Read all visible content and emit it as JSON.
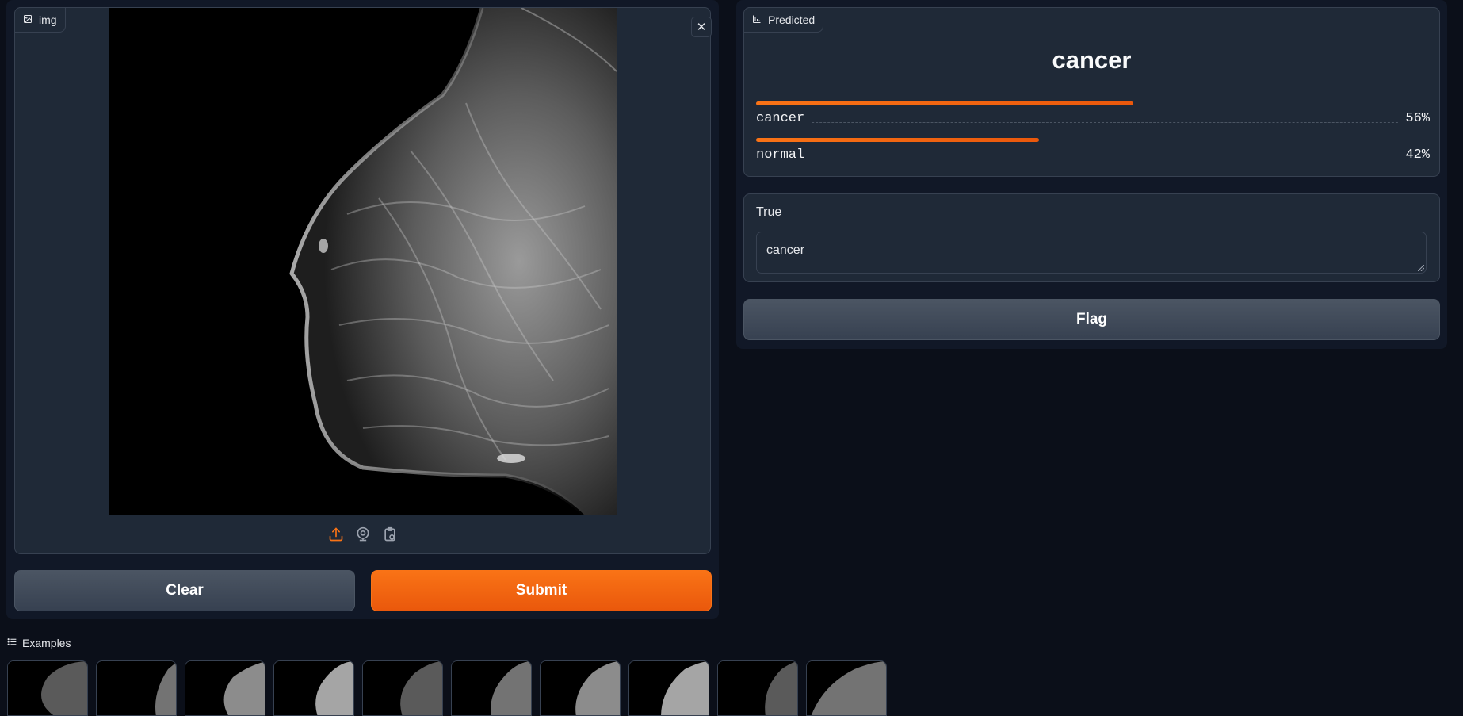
{
  "input": {
    "label": "img",
    "label_icon": "image-icon",
    "close_icon": "close-icon",
    "toolbar": [
      {
        "name": "upload-icon",
        "color": "#f97316"
      },
      {
        "name": "webcam-icon",
        "color": "#9ca3af"
      },
      {
        "name": "clipboard-icon",
        "color": "#9ca3af"
      }
    ]
  },
  "actions": {
    "clear_label": "Clear",
    "submit_label": "Submit"
  },
  "output": {
    "label": "Predicted",
    "label_icon": "bar-chart-icon",
    "top_label": "cancer",
    "confidences": [
      {
        "label": "cancer",
        "value": "56%",
        "fraction": 0.56
      },
      {
        "label": "normal",
        "value": "42%",
        "fraction": 0.42
      }
    ]
  },
  "true_field": {
    "label": "True",
    "value": "cancer"
  },
  "flag_label": "Flag",
  "examples": {
    "label": "Examples",
    "icon": "list-icon",
    "count": 10
  },
  "colors": {
    "accent": "#f97316",
    "background": "#0b0f19",
    "panel": "#1f2937",
    "border": "#374151"
  }
}
